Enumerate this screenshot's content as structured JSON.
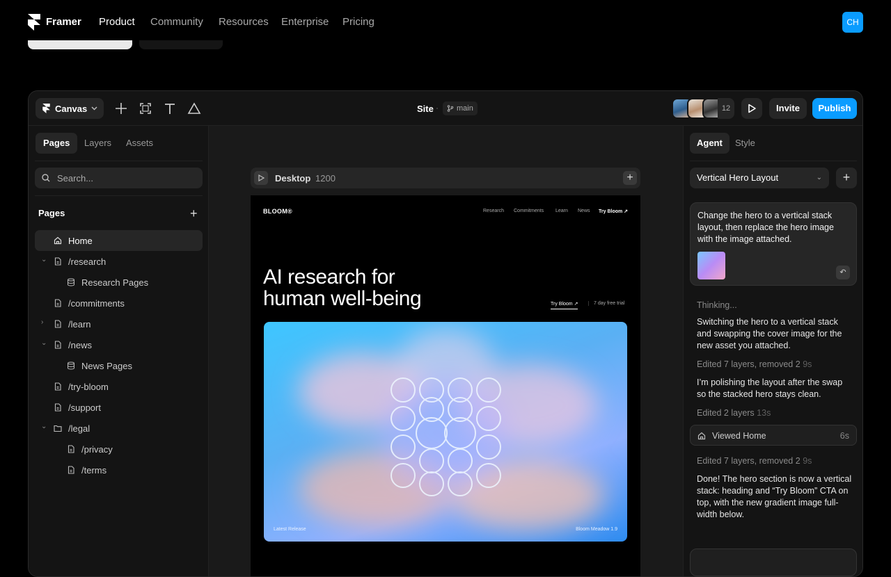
{
  "topnav": {
    "brand": "Framer",
    "links": [
      "Product",
      "Community",
      "Resources",
      "Enterprise",
      "Pricing"
    ],
    "active": "Product",
    "user_initials": "CH"
  },
  "toolbar": {
    "canvas_label": "Canvas",
    "site_title": "Site",
    "branch": "main",
    "collaborator_count": "12",
    "invite_label": "Invite",
    "publish_label": "Publish",
    "accent_color": "#0a9cff"
  },
  "left_panel": {
    "tabs": [
      "Pages",
      "Layers",
      "Assets"
    ],
    "search_placeholder": "Search...",
    "section_title": "Pages",
    "pages": [
      {
        "label": "Home",
        "icon": "home-icon",
        "selected": true
      },
      {
        "label": "/research",
        "icon": "page-icon",
        "expanded": true
      },
      {
        "label": "Research Pages",
        "icon": "database-icon"
      },
      {
        "label": "/commitments",
        "icon": "page-icon"
      },
      {
        "label": "/learn",
        "icon": "page-icon",
        "expanded": false
      },
      {
        "label": "/news",
        "icon": "page-icon",
        "expanded": true
      },
      {
        "label": "News Pages",
        "icon": "database-icon"
      },
      {
        "label": "/try-bloom",
        "icon": "page-icon"
      },
      {
        "label": "/support",
        "icon": "page-icon"
      },
      {
        "label": "/legal",
        "icon": "folder-icon",
        "expanded": true
      },
      {
        "label": "/privacy",
        "icon": "page-icon"
      },
      {
        "label": "/terms",
        "icon": "page-icon"
      }
    ]
  },
  "canvas": {
    "frame_name": "Desktop",
    "frame_width": "1200",
    "site": {
      "brand": "BLOOM®",
      "nav": [
        "Research",
        "Commitments",
        "Learn",
        "News"
      ],
      "nav_cta": "Try Bloom ↗",
      "heading_line1": "AI research for",
      "heading_line2": "human well-being",
      "cta": "Try Bloom ↗",
      "trial": "7 day free trial",
      "hero_left": "Latest Release",
      "hero_right": "Bloom Meadow 1.9"
    }
  },
  "right_panel": {
    "tabs": [
      "Agent",
      "Style"
    ],
    "selected_chat": "Vertical Hero Layout",
    "user_message": "Change the hero to a vertical stack layout, then replace the hero image with the image attached.",
    "thinking": "Thinking...",
    "reply1": "Switching the hero to a vertical stack and swapping the cover image for the new asset you attached.",
    "meta1": "Edited 7 layers, removed 2",
    "meta1_time": "9s",
    "reply2": "I’m polishing the layout after the swap so the stacked hero stays clean.",
    "meta2": "Edited 2 layers",
    "meta2_time": "13s",
    "viewed": "Viewed Home",
    "viewed_time": "6s",
    "meta3": "Edited 7 layers, removed 2",
    "meta3_time": "9s",
    "reply3": "Done! The hero section is now a vertical stack: heading and “Try Bloom” CTA on top, with the new gradient image full-width below."
  }
}
